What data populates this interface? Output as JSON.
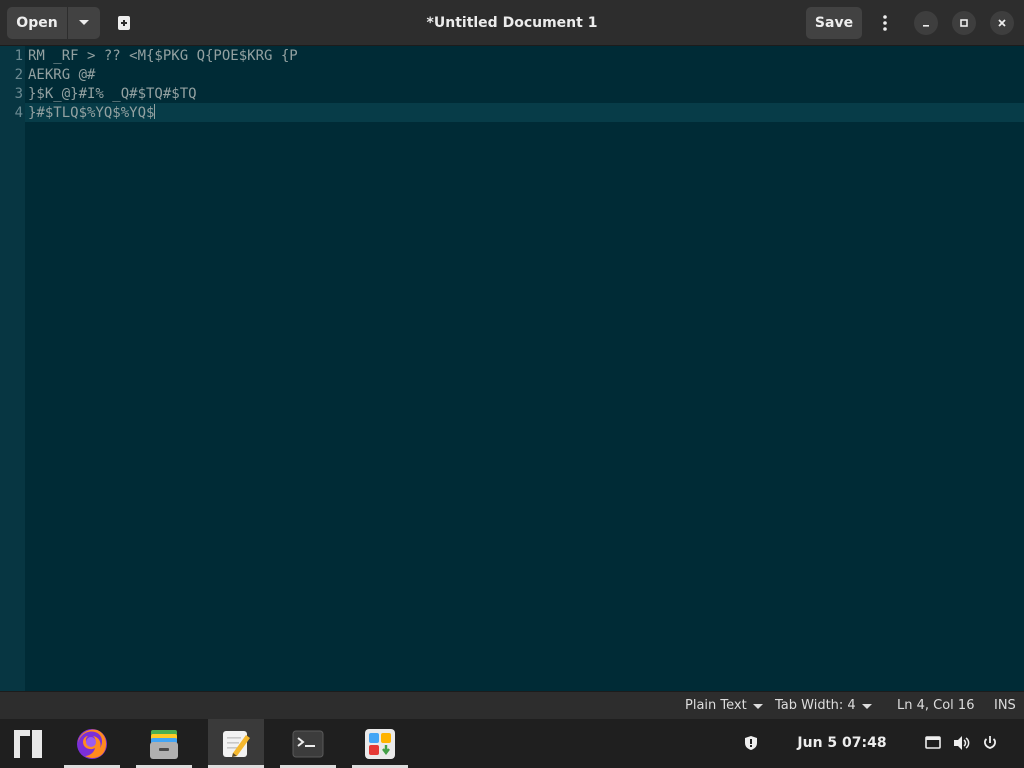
{
  "header": {
    "open_label": "Open",
    "title": "*Untitled Document 1",
    "save_label": "Save"
  },
  "editor": {
    "lines": [
      {
        "num": "1",
        "text": "RM _RF > ?? <M{$PKG Q{POE$KRG {P"
      },
      {
        "num": "2",
        "text": "AEKRG @#"
      },
      {
        "num": "3",
        "text": "}$K_@}#I% _Q#$TQ#$TQ"
      },
      {
        "num": "4",
        "text": "}#$TLQ$%YQ$%YQ$"
      }
    ]
  },
  "statusbar": {
    "language": "Plain Text",
    "tab_width": "Tab Width: 4",
    "position": "Ln 4, Col 16",
    "mode": "INS"
  },
  "taskbar": {
    "clock": "Jun 5  07:48",
    "apps": [
      {
        "name": "manjaro-logo-icon"
      },
      {
        "name": "firefox-icon"
      },
      {
        "name": "file-manager-icon"
      },
      {
        "name": "text-editor-icon"
      },
      {
        "name": "terminal-icon"
      },
      {
        "name": "software-center-icon"
      }
    ]
  },
  "colors": {
    "editor_bg": "#002b36",
    "gutter_bg": "#073642",
    "text": "#93a1a1",
    "header_bg": "#2d2d2d",
    "taskbar_bg": "#1f1f1f"
  }
}
